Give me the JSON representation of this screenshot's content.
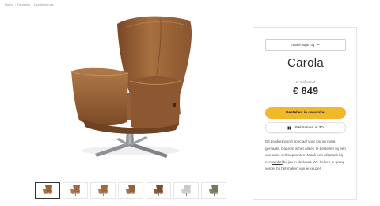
{
  "breadcrumb": [
    "Home",
    "Fauteuils",
    "Draaifauteuils"
  ],
  "product": {
    "name": "Carola",
    "variant": "Textiel hoge rug",
    "stock_label": "In stof vanaf",
    "price": "€ 849",
    "buy_label": "Bestellen in de winkel",
    "compose_label": "Stel samen in 3D",
    "description_before_link": "Dit product wordt speciaal voor jou op maat gemaakt. Daarom is het alleen te bestellen bij één van onze verkooppunten. Maak een afspraak bij een ",
    "description_link": "winkel",
    "description_after_link": " bij jou in de buurt. We helpen je graag verder bij het maken van je keuze!"
  },
  "thumbnails": [
    {
      "label": "cognac chair front",
      "color": "#9b6237",
      "active": true
    },
    {
      "label": "cognac chair side",
      "color": "#9f6a42",
      "active": false
    },
    {
      "label": "cognac chair angle",
      "color": "#a06a40",
      "active": false
    },
    {
      "label": "cognac chair back",
      "color": "#98613a",
      "active": false
    },
    {
      "label": "brown chair low",
      "color": "#7b4d30",
      "active": false
    },
    {
      "label": "grey chair",
      "color": "#c9cbcd",
      "active": false
    },
    {
      "label": "green chair",
      "color": "#6f7a5e",
      "active": false
    }
  ],
  "colors": {
    "accent": "#f2b829",
    "leather": "#9b6237",
    "leather_dark": "#6f4223",
    "base": "#8e9296"
  },
  "icons": {
    "variant_chevron": "chevron-down-icon",
    "compose": "cube-3d-icon"
  }
}
